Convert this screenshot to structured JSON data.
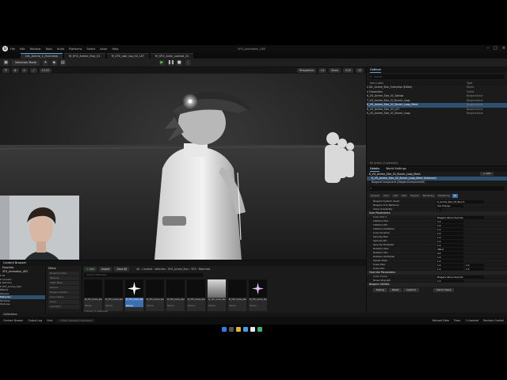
{
  "window": {
    "title": "VFX_Animation_UE5",
    "menu": [
      "File",
      "Edit",
      "Window",
      "Tools",
      "Build",
      "Platforms",
      "Select",
      "Actor",
      "Help"
    ]
  },
  "tabs": [
    {
      "label": "LVL_Anime_1_Overview"
    },
    {
      "label": "M_VFX_Anime_Star_01"
    },
    {
      "label": "M_VFX_star_loo_02_LST"
    },
    {
      "label": "M_VFX_Anim_vadrod_01"
    }
  ],
  "toolbar": {
    "save_label": "Save",
    "mode_label": "Selection Mode",
    "add_label": "+",
    "play_label": "▶"
  },
  "viewport": {
    "perspective_label": "Perspective",
    "lit_label": "Lit",
    "show_label": "Show",
    "speed_label": "0.25",
    "zoom_label": "0.125",
    "scale_label": "10"
  },
  "outliner": {
    "title": "Outliner",
    "search_placeholder": "Search...",
    "col_label": "Item Label",
    "col_type": "Type",
    "rows": [
      {
        "name": "▾ LVL_Anime_Star_Overview (Editor)",
        "type": "World"
      },
      {
        "name": "  ▾ Characters",
        "type": "Folder"
      },
      {
        "name": "     K_VG_Anime_Star_01_Santas",
        "type": "NiagaraActor"
      },
      {
        "name": "     T_VG_Anime_Star_02_Bunch_Loop",
        "type": "NiagaraActor"
      },
      {
        "name": "     K_VG_Anime_Star_02_Bunch_Loop_Mesh",
        "type": "NiagaraActor"
      },
      {
        "name": "     K_VG_Anime_Star_03_LST",
        "type": "NiagaraActor"
      },
      {
        "name": "     K_VG_Anime_Star_01_Bunch_Loop",
        "type": "NiagaraActor"
      }
    ],
    "selected_index": 4,
    "status": "65 actors (1 selected)"
  },
  "details": {
    "tab_details": "Details",
    "tab_world": "World Settings",
    "actor_name": "K_VG_Anime_Star_02_Bunch_Loop_Mesh",
    "add_label": "+ Add",
    "components": [
      {
        "label": "K_VG_Anime_Star_02_Bunch_Loop_Mesh (Instance)"
      },
      {
        "label": "NiagaraComponent (NiagaraComponent0)"
      }
    ],
    "filters": [
      "General",
      "Actor",
      "LOD",
      "Misc",
      "Physics",
      "Rendering",
      "Streaming",
      "All"
    ],
    "top_props": [
      {
        "name": "Niagara System Asset",
        "value": "K_Anime_Star_03_Bunch"
      },
      {
        "name": "Niagara Tick Behavior",
        "value": "Use Prereqs"
      },
      {
        "name": "Allow Scalability",
        "value": "✓"
      }
    ],
    "user_params_label": "User Parameters",
    "props": [
      {
        "name": "Color Tint 1",
        "value": "Niagara Value Override"
      },
      {
        "name": "Lifetime Max",
        "value": "1.5"
      },
      {
        "name": "Lifetime Min",
        "value": "1.0"
      },
      {
        "name": "Lifetime Multiplier",
        "value": "1.0"
      },
      {
        "name": "Loop Duration",
        "value": "2.0"
      },
      {
        "name": "Opacity Max",
        "value": "1.0"
      },
      {
        "name": "Opacity Min",
        "value": "1.0"
      },
      {
        "name": "Opacity Multiplier",
        "value": "1.0"
      },
      {
        "name": "Rotation Max",
        "value": "360.0"
      },
      {
        "name": "Rotation Min",
        "value": "0.0"
      },
      {
        "name": "Rotation Multiplier",
        "value": "1.0"
      },
      {
        "name": "Spawn Rate",
        "value": "1.0"
      },
      {
        "name": "Scale Max",
        "value": "1.0",
        "value2": "1.0"
      },
      {
        "name": "Scale Min",
        "value": "1.0",
        "value2": "1.0"
      }
    ],
    "extra_section": "Override Parameters",
    "extra_props": [
      {
        "name": "Color Curve",
        "value": "Niagara Value Override"
      },
      {
        "name": "Noise Strength",
        "value": "1.0"
      }
    ],
    "preview_section": "Niagara Utilities",
    "buttons": [
      "Debug",
      "Reset",
      "Capture"
    ],
    "set_to_value_label": "Set to Value"
  },
  "content_browser": {
    "title": "Content Browser",
    "favorites_label": "Favorites",
    "project_label": "VFX_Animation_UE5",
    "tree": [
      {
        "label": "▾ All"
      },
      {
        "label": "  ▾ Content"
      },
      {
        "label": "    ▸ Vehicles"
      },
      {
        "label": "    ▾ VFX_Anime_Star"
      },
      {
        "label": "        Effects"
      },
      {
        "label": "        Meshes"
      },
      {
        "label": "        Materials"
      },
      {
        "label": "        Particles"
      },
      {
        "label": "        Textures"
      }
    ],
    "selected_tree_index": 6,
    "filters_label": "Filters",
    "filter_items": [
      "Blueprint Class",
      "Material",
      "Static Mesh",
      "Texture",
      "Niagara System",
      "Sound Wave",
      "Level",
      "Animation"
    ],
    "add_label": "+ Add",
    "import_label": "Import",
    "save_all_label": "Save All",
    "breadcrumb": "All  ›  Content  ›  Vehicles  ›  VFX_Anime_Star  ›  VFX  ›  Materials",
    "search_placeholder": "Search Materials",
    "assets": [
      {
        "name": "M_VFX_Anime_Star_01",
        "kind": "Material"
      },
      {
        "name": "M_VFX_Anime_Star_02",
        "kind": "Material"
      },
      {
        "name": "M_VFX_Anime_Star_Procedural_01",
        "kind": "Material"
      },
      {
        "name": "M_VFX_Anime_Star_03",
        "kind": "Material"
      },
      {
        "name": "M_VFX_Anime_Star_04",
        "kind": "Material"
      },
      {
        "name": "M_VFX_Anime_Star_05",
        "kind": "Material"
      },
      {
        "name": "M_VFX_Anime_Star_06",
        "kind": "Material"
      },
      {
        "name": "M_VFX_Anime_Star_07",
        "kind": "Material"
      },
      {
        "name": "M_VFX_Anime_Star_08",
        "kind": "Material"
      }
    ],
    "selected_asset_index": 2,
    "count_label": "9 items (1 selected)",
    "collections_label": "Collections"
  },
  "statusbar": {
    "content_drawer": "Content Drawer",
    "output_log": "Output Log",
    "cmd": "Cmd",
    "console_placeholder": "Enter Console Command",
    "derived_data": "Derived Data",
    "trace": "Trace",
    "source_control": "Source Control",
    "unsaved": "1 Unsaved",
    "revision_control": "Revision Control"
  },
  "colors": {
    "accent": "#3b6fb0",
    "selection": "#2f4f6e",
    "play_green": "#5bd45b"
  }
}
